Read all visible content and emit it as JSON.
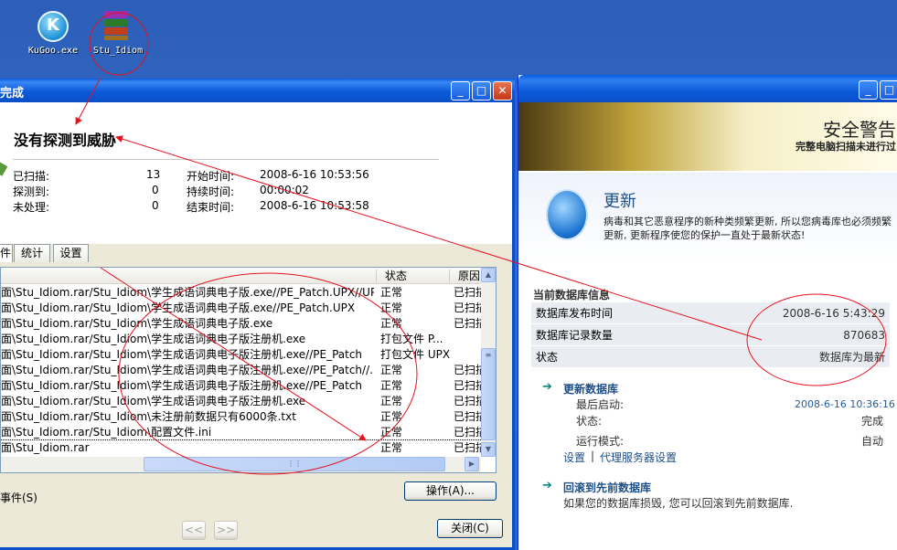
{
  "desktop": {
    "icons": [
      {
        "label": "KuGoo.exe"
      },
      {
        "label": "Stu_Idiom"
      }
    ]
  },
  "scan_dialog": {
    "title": "完成",
    "headline": "没有探测到威胁",
    "stats": {
      "scanned_label": "已扫描:",
      "scanned_value": "13",
      "detected_label": "探测到:",
      "detected_value": "0",
      "unhandled_label": "未处理:",
      "unhandled_value": "0",
      "start_label": "开始时间:",
      "start_value": "2008-6-16 10:53:56",
      "duration_label": "持续时间:",
      "duration_value": "00:00:02",
      "end_label": "结束时间:",
      "end_value": "2008-6-16 10:53:58"
    },
    "tabs": [
      "件",
      "统计",
      "设置"
    ],
    "columns": {
      "status": "状态",
      "reason": "原因"
    },
    "rows": [
      {
        "path": "面\\Stu_Idiom.rar/Stu_Idiom\\学生成语词典电子版.exe//PE_Patch.UPX//UPX",
        "status": "正常",
        "reason": "已扫描"
      },
      {
        "path": "面\\Stu_Idiom.rar/Stu_Idiom\\学生成语词典电子版.exe//PE_Patch.UPX",
        "status": "正常",
        "reason": "已扫描"
      },
      {
        "path": "面\\Stu_Idiom.rar/Stu_Idiom\\学生成语词典电子版.exe",
        "status": "正常",
        "reason": "已扫描"
      },
      {
        "path": "面\\Stu_Idiom.rar/Stu_Idiom\\学生成语词典电子版注册机.exe",
        "status": "打包文件 P...",
        "reason": ""
      },
      {
        "path": "面\\Stu_Idiom.rar/Stu_Idiom\\学生成语词典电子版注册机.exe//PE_Patch",
        "status": "打包文件 UPX",
        "reason": ""
      },
      {
        "path": "面\\Stu_Idiom.rar/Stu_Idiom\\学生成语词典电子版注册机.exe//PE_Patch//...",
        "status": "正常",
        "reason": "已扫描"
      },
      {
        "path": "面\\Stu_Idiom.rar/Stu_Idiom\\学生成语词典电子版注册机.exe//PE_Patch",
        "status": "正常",
        "reason": "已扫描"
      },
      {
        "path": "面\\Stu_Idiom.rar/Stu_Idiom\\学生成语词典电子版注册机.exe",
        "status": "正常",
        "reason": "已扫描"
      },
      {
        "path": "面\\Stu_Idiom.rar/Stu_Idiom\\未注册前数据只有6000条.txt",
        "status": "正常",
        "reason": "已扫描"
      },
      {
        "path": "面\\Stu_Idiom.rar/Stu_Idiom\\配置文件.ini",
        "status": "正常",
        "reason": "已扫描"
      },
      {
        "path": "面\\Stu_Idiom.rar",
        "status": "正常",
        "reason": "已扫描"
      }
    ],
    "events_label": "事件(S)",
    "action_button": "操作(A)...",
    "prev_button": "<<",
    "next_button": ">>",
    "close_button": "关闭(C)"
  },
  "security_window": {
    "banner_title": "安全警告",
    "banner_subtitle": "完整电脑扫描未进行过",
    "update_heading": "更新",
    "update_desc": "病毒和其它恶意程序的新种类频繁更新, 所以您病毒库也必须频繁更新, 更新程序使您的保护一直处于最新状态!",
    "db_section_title": "当前数据库信息",
    "db_rows": [
      {
        "label": "数据库发布时间",
        "value": "2008-6-16 5:43:29"
      },
      {
        "label": "数据库记录数量",
        "value": "870683"
      },
      {
        "label": "状态",
        "value": "数据库为最新"
      }
    ],
    "update_db_link": "更新数据库",
    "last_start_label": "最后启动:",
    "last_start_value": "2008-6-16 10:36:16",
    "status_label": "状态:",
    "status_value": "完成",
    "run_mode_label": "运行模式:",
    "run_mode_value": "自动",
    "settings_link": "设置",
    "separator": "|",
    "proxy_link": "代理服务器设置",
    "rollback_link": "回滚到先前数据库",
    "rollback_desc": "如果您的数据库损毁, 您可以回滚到先前数据库."
  },
  "colors": {
    "annotation": "#e8121e",
    "title_bar": "#0a5fe0",
    "link": "#1d4e89"
  }
}
